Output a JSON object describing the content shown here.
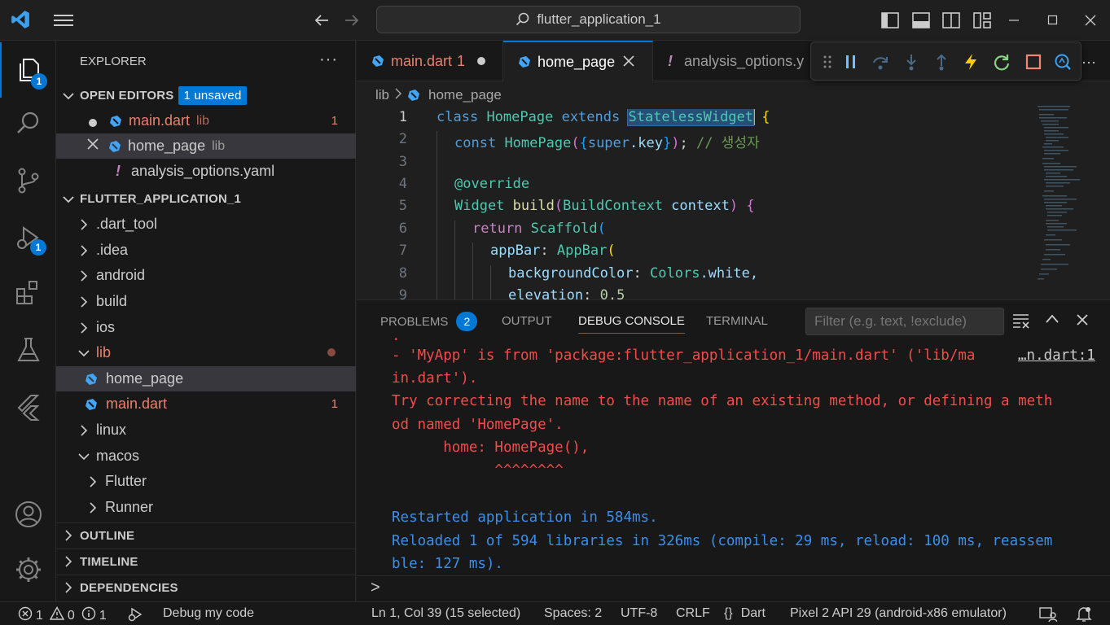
{
  "titlebar": {
    "search_text": "flutter_application_1"
  },
  "activity_bar": {
    "explorer_badge": "1",
    "debug_badge": "1"
  },
  "sidebar": {
    "title": "EXPLORER",
    "open_editors": {
      "header": "OPEN EDITORS",
      "unsaved_badge": "1 unsaved",
      "items": [
        {
          "name": "main.dart",
          "folder": "lib",
          "problems": "1"
        },
        {
          "name": "home_page",
          "folder": "lib"
        },
        {
          "name": "analysis_options.yaml"
        }
      ]
    },
    "project": {
      "header": "FLUTTER_APPLICATION_1",
      "items": [
        ".dart_tool",
        ".idea",
        "android",
        "build",
        "ios",
        "lib",
        "home_page",
        "main.dart",
        "linux",
        "macos",
        "Flutter",
        "Runner"
      ],
      "main_problems": "1"
    },
    "sections": {
      "outline": "OUTLINE",
      "timeline": "TIMELINE",
      "dependencies": "DEPENDENCIES"
    }
  },
  "editor": {
    "tabs": [
      {
        "label": "main.dart",
        "suffix": "1"
      },
      {
        "label": "home_page"
      },
      {
        "label": "analysis_options.y"
      }
    ],
    "breadcrumb": [
      "lib",
      "home_page"
    ],
    "line_numbers": [
      "1",
      "2",
      "3",
      "4",
      "5",
      "6",
      "7",
      "8",
      "9"
    ],
    "code": {
      "l1": {
        "kw1": "class",
        "name": "HomePage",
        "kw2": "extends",
        "sup": "StatelessWidget",
        "brace": "{"
      },
      "l2": {
        "kw": "const",
        "name": "HomePage",
        "p1": "(",
        "b1": "{",
        "sup": "super",
        "key": ".key",
        "b2": "}",
        "p2": ")",
        "semi": ";",
        "comment": "// 생성자"
      },
      "l4": {
        "ann": "@override"
      },
      "l5": {
        "type": "Widget",
        "fn": "build",
        "p1": "(",
        "ptype": "BuildContext",
        "param": " context",
        "p2": ")",
        "brace": "{"
      },
      "l6": {
        "kw": "return",
        "type": "Scaffold",
        "p": "("
      },
      "l7": {
        "prop": "appBar",
        "colon": ": ",
        "type": "AppBar",
        "p": "("
      },
      "l8": {
        "prop": "backgroundColor",
        "colon": ": ",
        "type": "Colors",
        "val": ".white,"
      },
      "l9": {
        "prop": "elevation",
        "colon": ": ",
        "val": "0.5"
      }
    }
  },
  "panel": {
    "tabs": {
      "problems": "PROBLEMS",
      "problems_count": "2",
      "output": "OUTPUT",
      "debug_console": "DEBUG CONSOLE",
      "terminal": "TERMINAL"
    },
    "filter_placeholder": "Filter (e.g. text, !exclude)",
    "source_link": "…n.dart:1",
    "lines": [
      {
        "text": ".",
        "kind": "err"
      },
      {
        "text": "- 'MyApp' is from 'package:flutter_application_1/main.dart' ('lib/ma",
        "kind": "err"
      },
      {
        "text": "in.dart').",
        "kind": "err"
      },
      {
        "text": "Try correcting the name to the name of an existing method, or defining a meth",
        "kind": "err"
      },
      {
        "text": "od named 'HomePage'.",
        "kind": "err"
      },
      {
        "text": "      home: HomePage(),",
        "kind": "err"
      },
      {
        "text": "            ^^^^^^^^",
        "kind": "err"
      },
      {
        "text": "",
        "kind": "inf"
      },
      {
        "text": "Restarted application in 584ms.",
        "kind": "inf"
      },
      {
        "text": "Reloaded 1 of 594 libraries in 326ms (compile: 29 ms, reload: 100 ms, reassem",
        "kind": "inf"
      },
      {
        "text": "ble: 127 ms).",
        "kind": "inf"
      }
    ],
    "prompt": ">"
  },
  "statusbar": {
    "errors": "1",
    "warnings": "0",
    "infos": "1",
    "debug_label": "Debug my code",
    "cursor": "Ln 1, Col 39 (15 selected)",
    "spaces": "Spaces: 2",
    "encoding": "UTF-8",
    "eol": "CRLF",
    "language_brace": "{}",
    "language": "Dart",
    "device": "Pixel 2 API 29 (android-x86 emulator)"
  },
  "colors": {
    "accent": "#0078d4",
    "error": "#f14c4c",
    "info": "#3b8eea",
    "modified_file": "#e9806f"
  }
}
